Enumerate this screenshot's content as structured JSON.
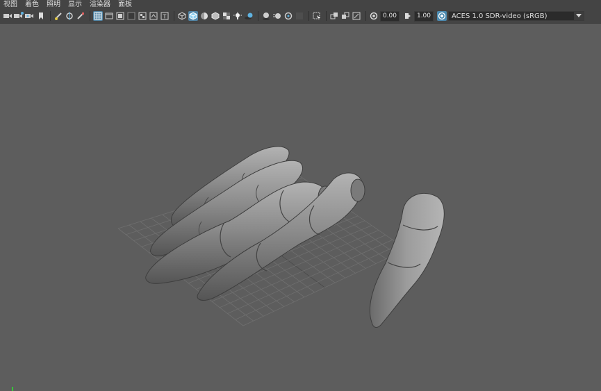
{
  "menu": {
    "items": [
      "视图",
      "着色",
      "照明",
      "显示",
      "渲染器",
      "面板"
    ]
  },
  "toolbar": {
    "exposure_value": "0.00",
    "gamma_value": "1.00",
    "color_space": "ACES 1.0 SDR-video (sRGB)",
    "icons": [
      "camera-select-icon",
      "camera-attributes-icon",
      "bookmark-icon",
      "image-plane-icon",
      "grease-pencil-icon",
      "2d-pan-zoom-icon",
      "grid-icon",
      "film-gate-icon",
      "resolution-gate-icon",
      "gate-mask-icon",
      "field-chart-icon",
      "safe-action-icon",
      "safe-title-icon",
      "wireframe-icon",
      "smooth-shade-icon",
      "default-material-icon",
      "xray-icon",
      "textured-icon",
      "lights-icon",
      "shadows-icon",
      "screen-space-ao-icon",
      "motion-blur-icon",
      "anti-aliasing-icon",
      "isolate-select-icon",
      "xray-joints-icon",
      "xray-active-icon",
      "backface-culling-icon",
      "exposure-icon",
      "gamma-icon",
      "color-space-icon"
    ],
    "active_icons": [
      "grid-icon",
      "smooth-shade-icon"
    ]
  },
  "colors": {
    "ui_background": "#444444",
    "viewport_background": "#5d5d5d",
    "highlight": "#5285a6",
    "mesh": "#8a8a8a",
    "grid": "#6e6e6e"
  }
}
